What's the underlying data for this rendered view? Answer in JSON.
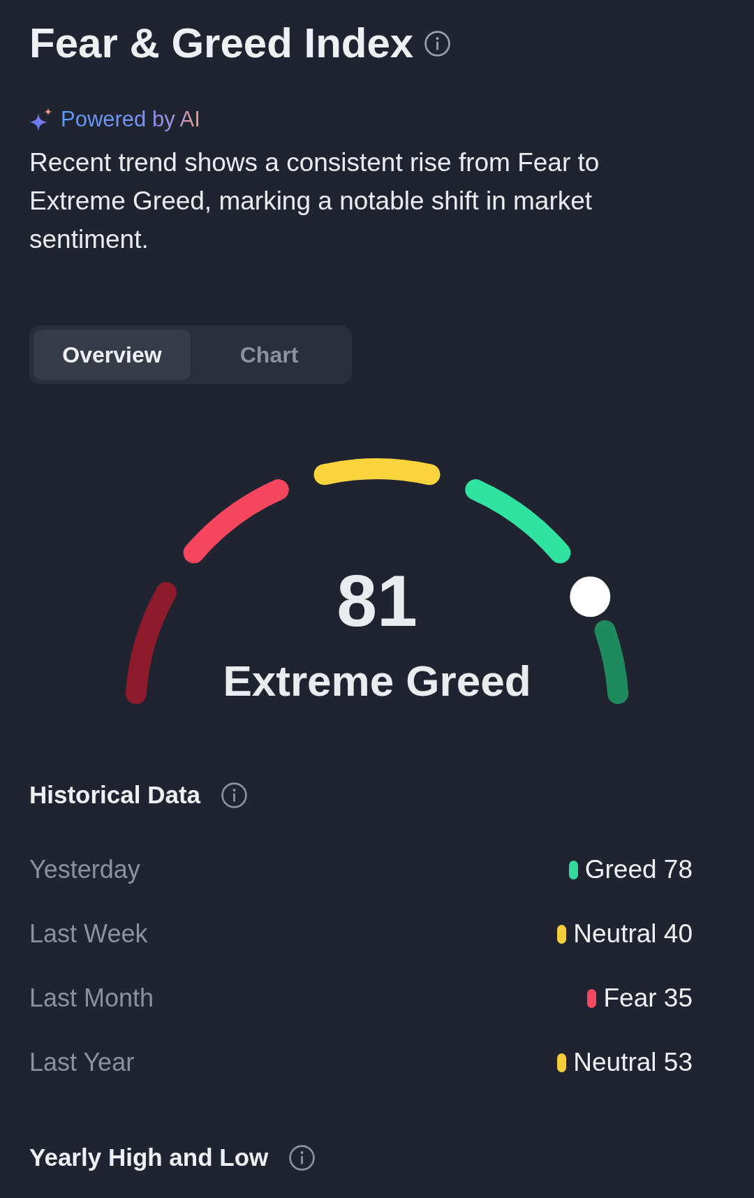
{
  "header": {
    "title": "Fear & Greed Index"
  },
  "ai_summary": {
    "badge": "Powered by AI",
    "text": "Recent trend shows a consistent rise from Fear to Extreme Greed, marking a notable shift in market sentiment."
  },
  "tabs": [
    {
      "label": "Overview",
      "selected": true
    },
    {
      "label": "Chart",
      "selected": false
    }
  ],
  "gauge": {
    "value": "81",
    "label": "Extreme Greed",
    "level": 0.86
  },
  "historical_data": {
    "title": "Historical Data",
    "rows": [
      {
        "period": "Yesterday",
        "value": "Greed 78",
        "color": "#31d99b"
      },
      {
        "period": "Last Week",
        "value": "Neutral 40",
        "color": "#f5cf3b"
      },
      {
        "period": "Last Month",
        "value": "Fear 35",
        "color": "#f24960"
      },
      {
        "period": "Last Year",
        "value": "Neutral 53",
        "color": "#f5cf3b"
      }
    ]
  },
  "yearly_high_low": {
    "title": "Yearly High and Low"
  }
}
